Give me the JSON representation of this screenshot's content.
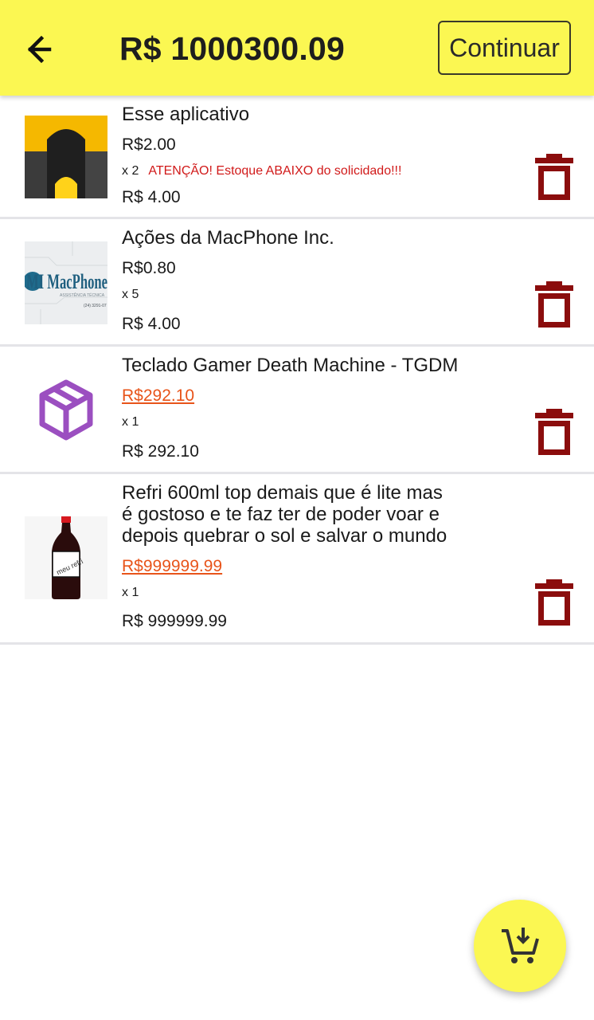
{
  "header": {
    "total": "R$ 1000300.09",
    "continue_label": "Continuar"
  },
  "cart": {
    "items": [
      {
        "name": "Esse aplicativo",
        "unit_price": "R$2.00",
        "quantity": "x 2",
        "warning": "ATENÇÃO! Estoque ABAIXO do solicidado!!!",
        "subtotal": "R$ 4.00"
      },
      {
        "name": "Ações da MacPhone Inc.",
        "unit_price": "R$0.80",
        "quantity": "x 5",
        "subtotal": "R$ 4.00",
        "logo_text": "MI MacPhone",
        "logo_caption": "ASSISTÊNCIA TÉCNICA",
        "logo_phone": "(24) 3291-07"
      },
      {
        "name": "Teclado Gamer Death Machine - TGDM",
        "unit_price": "R$292.10",
        "quantity": "x 1",
        "subtotal": "R$ 292.10"
      },
      {
        "name_lines": [
          "Refri 600ml top demais que é lite mas",
          "é gostoso e te faz ter de poder voar e",
          "depois quebrar o sol e salvar o mundo"
        ],
        "unit_price": "R$999999.99",
        "quantity": "x 1",
        "subtotal": "R$ 999999.99",
        "bottle_label": "meu refri"
      }
    ]
  },
  "colors": {
    "appbar": "#fbf752",
    "delete_icon": "#8b0d0d",
    "warning": "#d11a1a",
    "strike_price": "#e8541a",
    "package_icon": "#9b4fc0"
  },
  "icons": {
    "back": "arrow-left-icon",
    "delete": "trash-icon",
    "package": "package-icon",
    "fab": "cart-add-icon"
  }
}
